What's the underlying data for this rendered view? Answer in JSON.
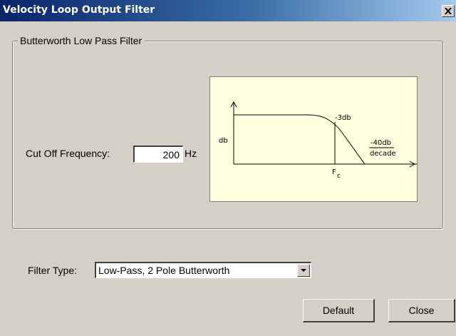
{
  "window": {
    "title": "Velocity Loop Output Filter"
  },
  "group": {
    "legend": "Butterworth Low Pass Filter"
  },
  "cutoff": {
    "label": "Cut Off Frequency:",
    "value": "200",
    "unit": "Hz"
  },
  "diagram": {
    "ylabel": "db",
    "point_label": "-3db",
    "slope_top": "-40db",
    "slope_bottom": "decade",
    "fc_main": "F",
    "fc_sub": "c"
  },
  "filter_type": {
    "label": "Filter Type:",
    "selected": "Low-Pass, 2 Pole Butterworth"
  },
  "buttons": {
    "default": "Default",
    "close": "Close"
  },
  "colors": {
    "title_start": "#0a246a",
    "title_end": "#a6caf0",
    "face": "#d4d0c8",
    "diagram_bg": "#ffffe0"
  },
  "icons": {
    "close": "close-icon",
    "dropdown": "chevron-down-icon"
  }
}
